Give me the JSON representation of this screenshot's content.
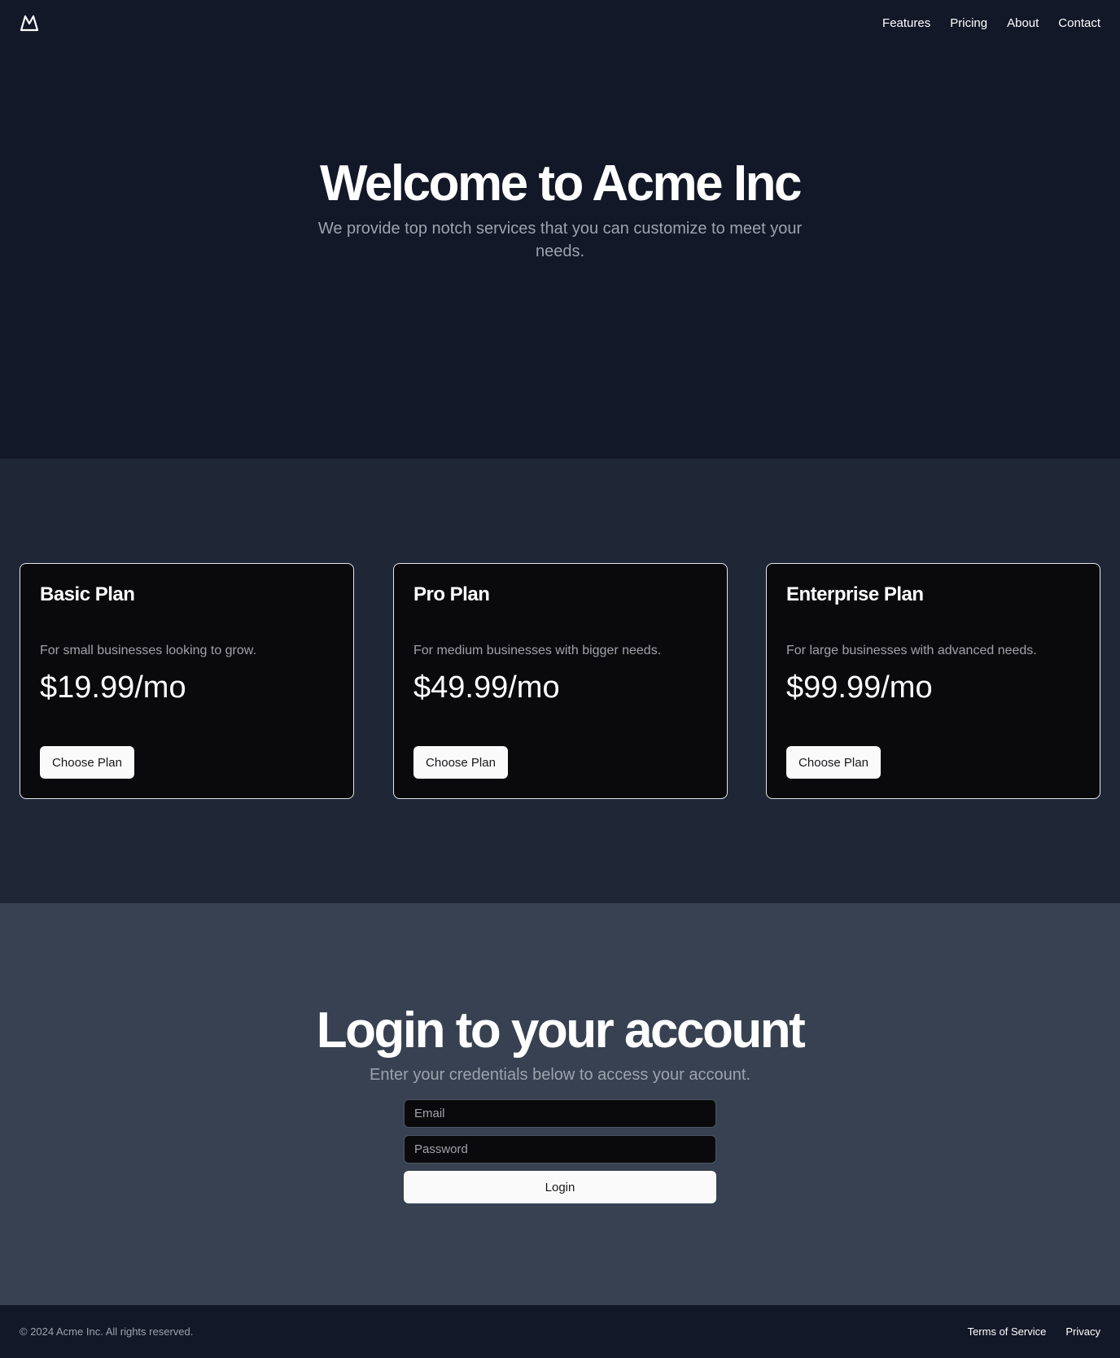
{
  "header": {
    "logo_icon": "mountain-icon",
    "nav": [
      {
        "label": "Features"
      },
      {
        "label": "Pricing"
      },
      {
        "label": "About"
      },
      {
        "label": "Contact"
      }
    ]
  },
  "hero": {
    "title": "Welcome to Acme Inc",
    "subtitle": "We provide top notch services that you can customize to meet your needs."
  },
  "plans": [
    {
      "name": "Basic Plan",
      "description": "For small businesses looking to grow.",
      "price": "$19.99/mo",
      "button": "Choose Plan"
    },
    {
      "name": "Pro Plan",
      "description": "For medium businesses with bigger needs.",
      "price": "$49.99/mo",
      "button": "Choose Plan"
    },
    {
      "name": "Enterprise Plan",
      "description": "For large businesses with advanced needs.",
      "price": "$99.99/mo",
      "button": "Choose Plan"
    }
  ],
  "login": {
    "title": "Login to your account",
    "subtitle": "Enter your credentials below to access your account.",
    "email_placeholder": "Email",
    "password_placeholder": "Password",
    "button": "Login"
  },
  "footer": {
    "copyright": "© 2024 Acme Inc. All rights reserved.",
    "links": [
      {
        "label": "Terms of Service"
      },
      {
        "label": "Privacy"
      }
    ]
  },
  "colors": {
    "hero_bg": "#121827",
    "pricing_bg": "#1f2737",
    "login_bg": "#374151",
    "card_bg": "#0a0a0c",
    "button_bg": "#fafafa"
  }
}
